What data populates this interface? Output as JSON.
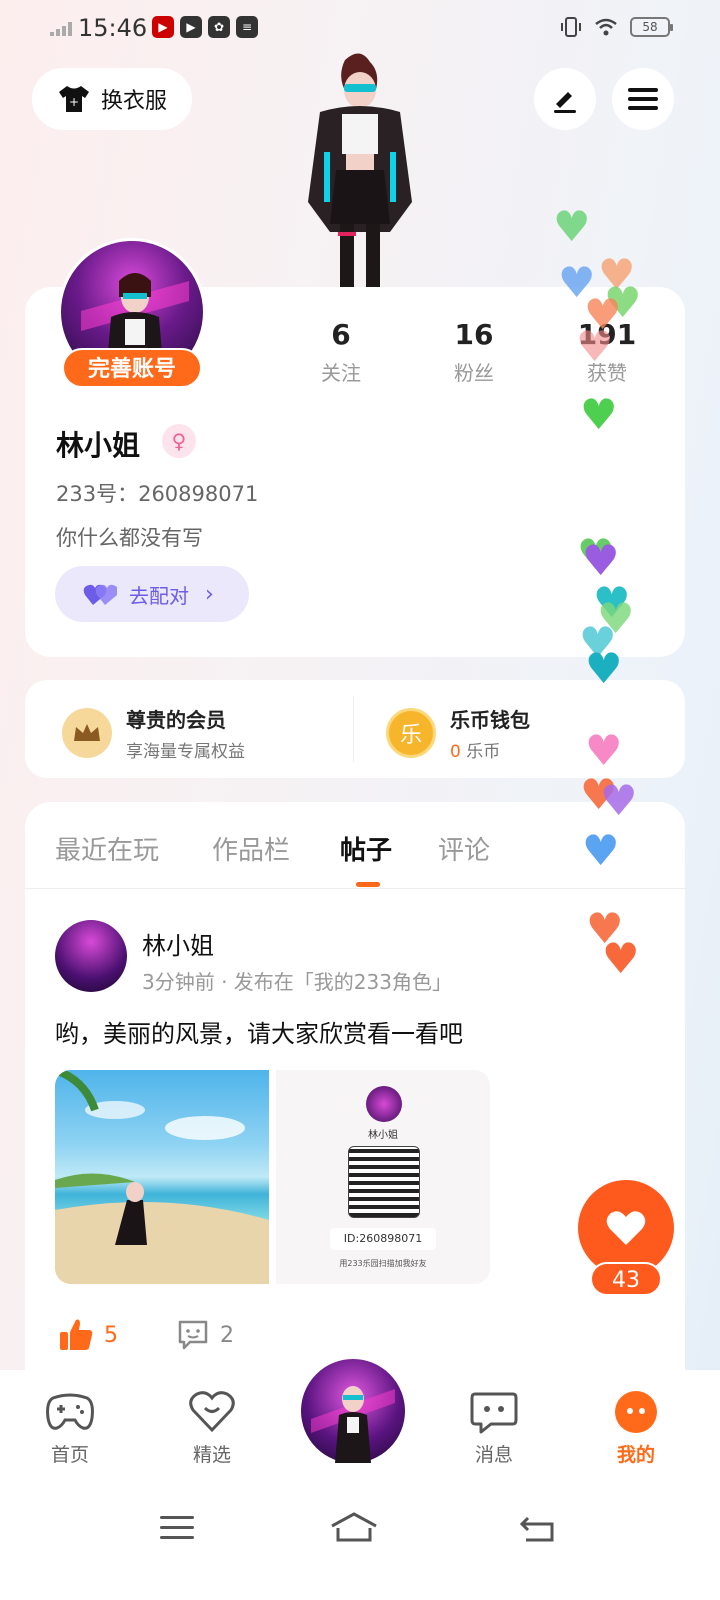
{
  "status_bar": {
    "time": "15:46",
    "battery": "58"
  },
  "top": {
    "outfit_label": "换衣服"
  },
  "profile": {
    "complete_label": "完善账号",
    "stats": [
      {
        "num": "6",
        "label": "关注"
      },
      {
        "num": "16",
        "label": "粉丝"
      },
      {
        "num": "191",
        "label": "获赞"
      }
    ],
    "name": "林小姐",
    "gender_symbol": "♀",
    "uid": "233号：260898071",
    "bio": "你什么都没有写",
    "match_label": "去配对"
  },
  "vip": {
    "member_title": "尊贵的会员",
    "member_sub": "享海量专属权益",
    "wallet_title": "乐币钱包",
    "wallet_amount": "0",
    "wallet_unit": "乐币",
    "wallet_icon_char": "乐"
  },
  "tabs": [
    {
      "label": "最近在玩",
      "active": false
    },
    {
      "label": "作品栏",
      "active": false
    },
    {
      "label": "帖子",
      "active": true
    },
    {
      "label": "评论",
      "active": false
    }
  ],
  "post": {
    "author": "林小姐",
    "meta": "3分钟前 · 发布在「我的233角色」",
    "text": "哟，美丽的风景，请大家欣赏看一看吧",
    "card_name": "林小姐",
    "card_id": "ID:260898071",
    "card_hint": "用233乐园扫描加我好友",
    "likes": "5",
    "comments": "2"
  },
  "fab": {
    "count": "43"
  },
  "nav": {
    "items": [
      {
        "label": "首页"
      },
      {
        "label": "精选"
      },
      {
        "label": "消息"
      },
      {
        "label": "我的"
      }
    ]
  },
  "colors": {
    "accent": "#ff5a1e",
    "match": "#6c5ce7"
  }
}
